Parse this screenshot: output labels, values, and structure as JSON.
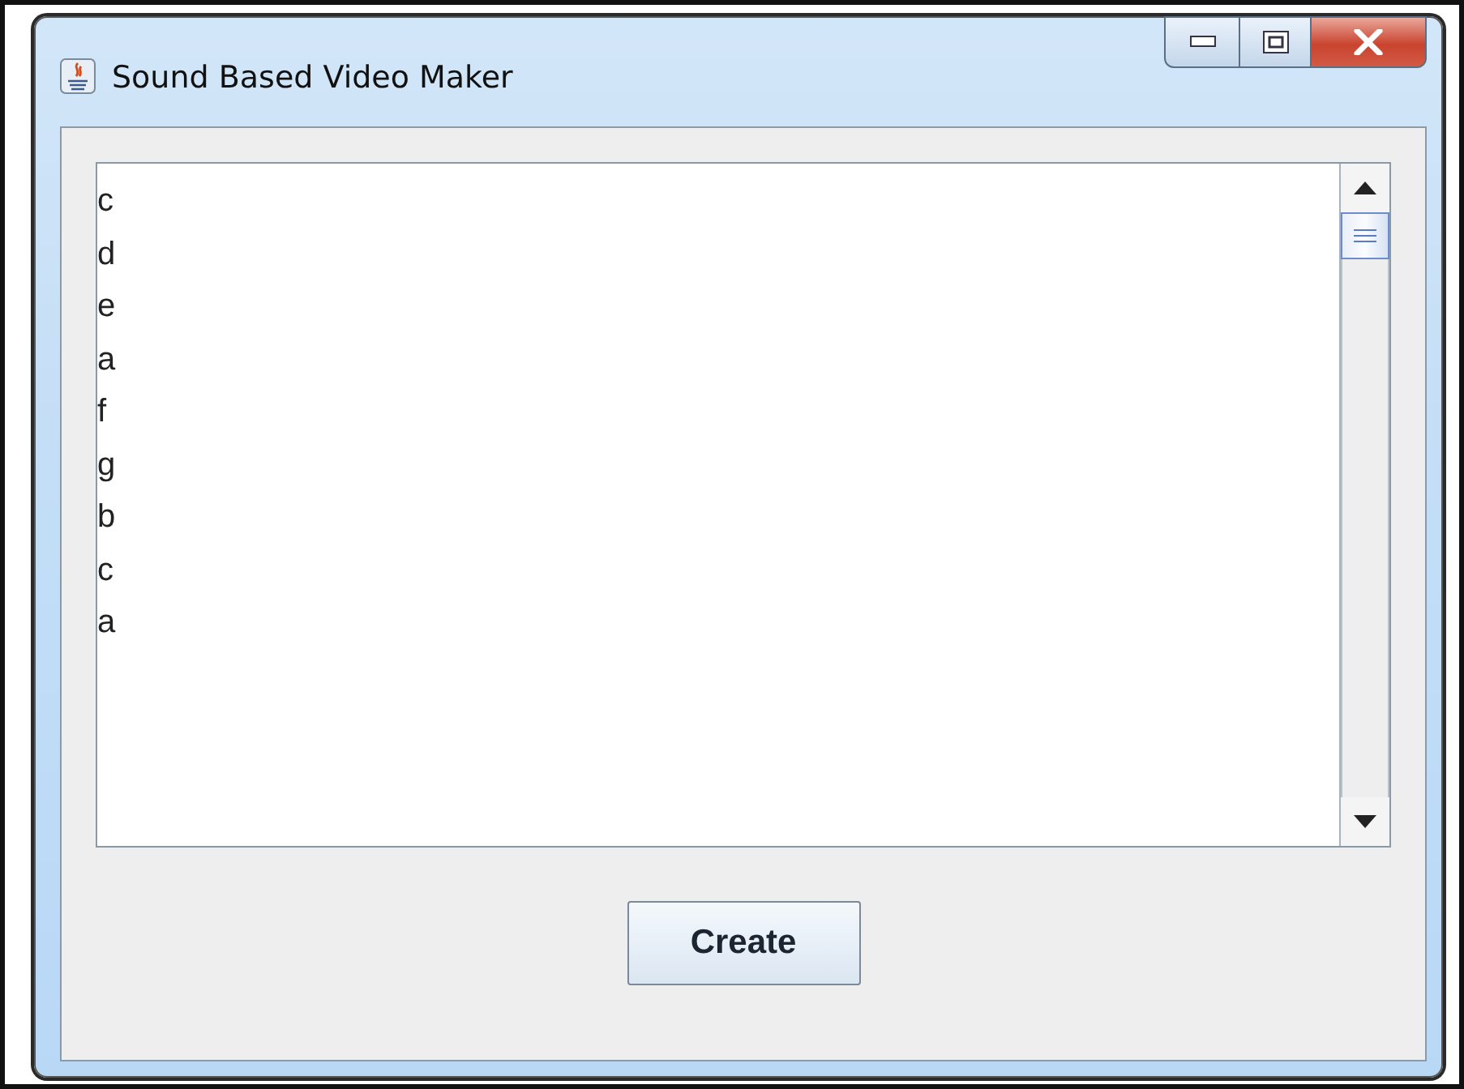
{
  "window": {
    "title": "Sound Based Video Maker"
  },
  "text_area": {
    "lines": [
      "c",
      "d",
      "e",
      "a",
      "f",
      "g",
      "b",
      "c",
      "a"
    ]
  },
  "buttons": [
    {
      "label": "Create"
    }
  ]
}
